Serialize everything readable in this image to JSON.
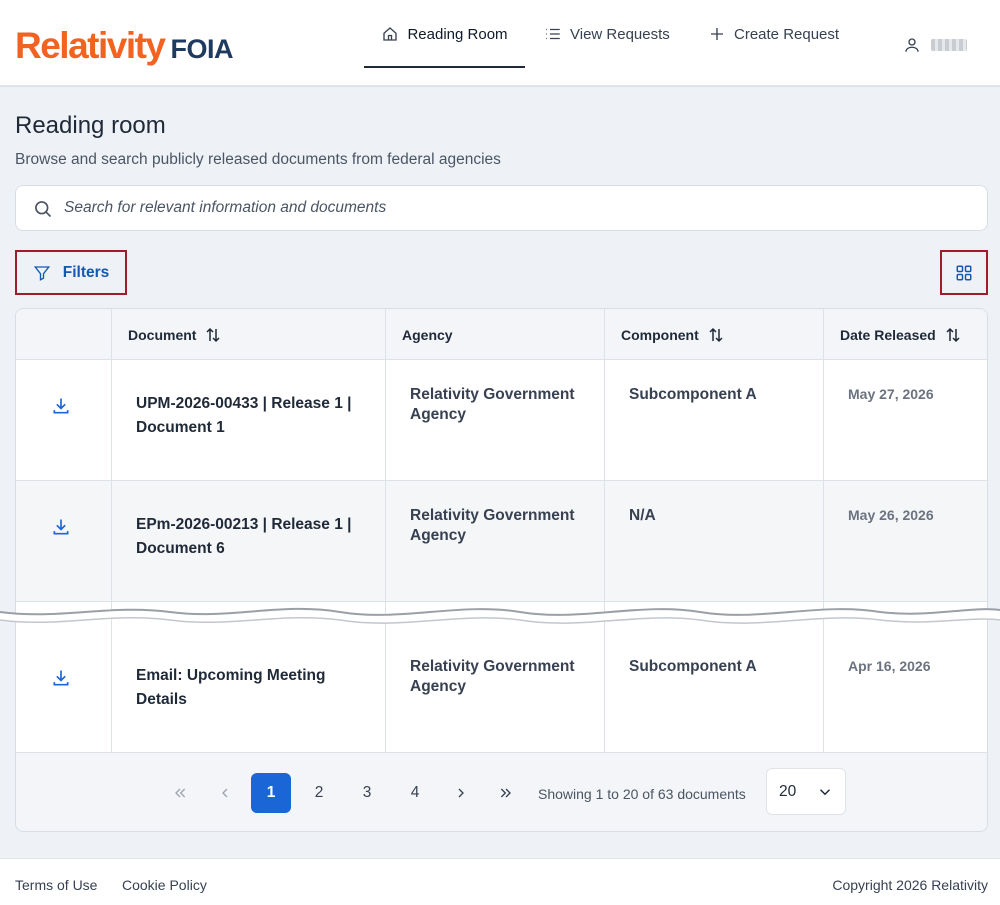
{
  "header": {
    "logo_main": "Relativity",
    "logo_sub": "FOIA",
    "nav": [
      {
        "label": "Reading Room",
        "icon": "home-icon",
        "active": true
      },
      {
        "label": "View Requests",
        "icon": "list-icon",
        "active": false
      },
      {
        "label": "Create Request",
        "icon": "plus-icon",
        "active": false
      }
    ],
    "user_icon": "user-icon"
  },
  "page": {
    "title": "Reading room",
    "subtitle": "Browse and search publicly released documents from federal agencies"
  },
  "search": {
    "placeholder": "Search for relevant information and documents"
  },
  "toolbar": {
    "filters_label": "Filters",
    "view_toggle_icon": "grid-view-icon"
  },
  "table": {
    "columns": [
      "Document",
      "Agency",
      "Component",
      "Date Released"
    ],
    "rows": [
      {
        "document_line1": "UPM-2026-00433 | Release 1 |",
        "document_line2": "Document 1",
        "agency_line1": "Relativity Government",
        "agency_line2": "Agency",
        "component": "Subcomponent A",
        "date": "May 27, 2026"
      },
      {
        "document_line1": "EPm-2026-00213 | Release 1 |",
        "document_line2": "Document 6",
        "agency_line1": "Relativity Government",
        "agency_line2": "Agency",
        "component": "N/A",
        "date": "May 26, 2026"
      },
      {
        "document_line1": "Email: Upcoming Meeting",
        "document_line2": "Details",
        "agency_line1": "Relativity Government",
        "agency_line2": "Agency",
        "component": "Subcomponent A",
        "date": "Apr 16, 2026"
      }
    ]
  },
  "pagination": {
    "pages": [
      "1",
      "2",
      "3",
      "4"
    ],
    "current_page": "1",
    "showing_text": "Showing 1 to 20 of 63 documents",
    "page_size": "20"
  },
  "footer": {
    "terms": "Terms of Use",
    "cookie": "Cookie Policy",
    "copyright": "Copyright 2026 Relativity"
  },
  "colors": {
    "brand_orange": "#f26322",
    "brand_navy": "#1f3a5f",
    "accent_blue": "#1a66d6",
    "highlight_red": "#a01c2a"
  }
}
